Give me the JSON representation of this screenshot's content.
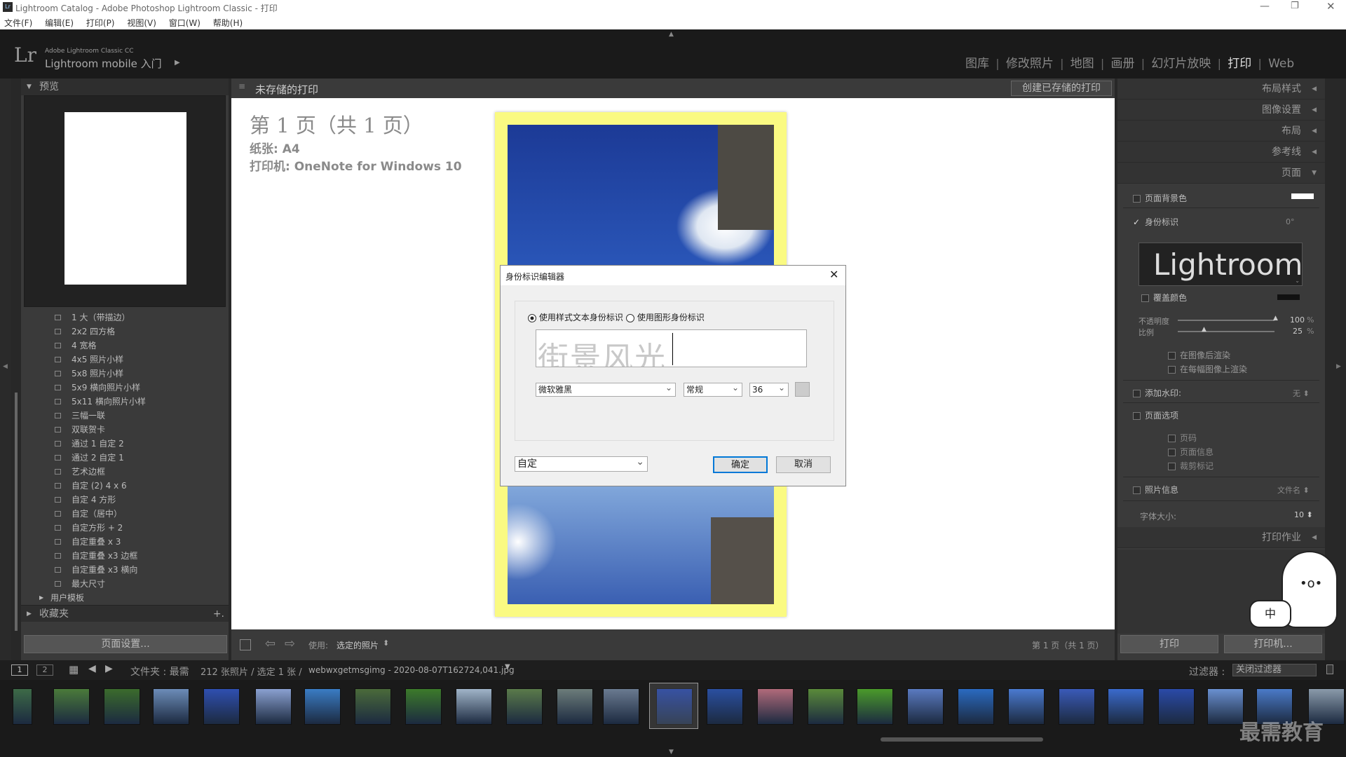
{
  "window": {
    "title": "Lightroom Catalog - Adobe Photoshop Lightroom Classic - 打印",
    "app_icon": "Lr"
  },
  "menu": [
    "文件(F)",
    "编辑(E)",
    "打印(P)",
    "视图(V)",
    "窗口(W)",
    "帮助(H)"
  ],
  "identity": {
    "logo": "Lr",
    "line1": "Adobe Lightroom Classic CC",
    "line2": "Lightroom mobile 入门"
  },
  "modules": [
    {
      "label": "图库"
    },
    {
      "label": "修改照片"
    },
    {
      "label": "地图"
    },
    {
      "label": "画册"
    },
    {
      "label": "幻灯片放映"
    },
    {
      "label": "打印",
      "active": true
    },
    {
      "label": "Web"
    }
  ],
  "left": {
    "preview_title": "预览",
    "templates": [
      "1 大（带描边）",
      "2x2 四方格",
      "4 宽格",
      "4x5 照片小样",
      "5x8 照片小样",
      "5x9 横向照片小样",
      "5x11 横向照片小样",
      "三幅一联",
      "双联贺卡",
      "通过 1 自定 2",
      "通过 2 自定 1",
      "艺术边框",
      "自定 (2) 4 x 6",
      "自定 4 方形",
      "自定（居中）",
      "自定方形 + 2",
      "自定重叠 x 3",
      "自定重叠 x3 边框",
      "自定重叠 x3 横向",
      "最大尺寸"
    ],
    "user_templates": "用户模板",
    "collections": "收藏夹",
    "collections_add": "+.",
    "page_setup_btn": "页面设置..."
  },
  "center": {
    "header_title": "未存储的打印",
    "create_saved_btn": "创建已存储的打印",
    "page_info": "第 1 页（共 1 页）",
    "paper": "纸张: A4",
    "printer": "打印机: OneNote for Windows 10",
    "use_label": "使用:",
    "use_value": "选定的照片",
    "page_counter": "第 1 页（共 1 页）"
  },
  "right": {
    "sections": [
      "布局样式",
      "图像设置",
      "布局",
      "参考线",
      "页面"
    ],
    "page_bg_label": "页面背景色",
    "identity_plate_label": "身份标识",
    "identity_angle": "0°",
    "identity_text": "Lightroom",
    "override_color": "覆盖颜色",
    "opacity_label": "不透明度",
    "opacity_value": "100",
    "opacity_unit": "%",
    "scale_label": "比例",
    "scale_value": "25",
    "scale_unit": "%",
    "render_behind": "在图像后渲染",
    "render_each": "在每幅图像上渲染",
    "watermark_label": "添加水印:",
    "watermark_value": "无 ⬍",
    "page_options": "页面选项",
    "page_numbers": "页码",
    "page_info_opt": "页面信息",
    "crop_marks": "裁剪标记",
    "photo_info": "照片信息",
    "photo_info_value": "文件名 ⬍",
    "font_size_label": "字体大小:",
    "font_size_value": "10 ⬍",
    "print_job": "打印作业",
    "print_btn": "打印",
    "printer_btn": "打印机..."
  },
  "filmstrip": {
    "page1": "1",
    "page2": "2",
    "source": "文件夹 : 最需",
    "count": "212 张照片 / 选定 1 张 /",
    "filename": "webwxgetmsgimg - 2020-08-07T162724,041.jpg",
    "filter_label": "过滤器 :",
    "filter_value": "关闭过滤器"
  },
  "dialog": {
    "title": "身份标识编辑器",
    "radio_text": "使用样式文本身份标识",
    "radio_graphic": "使用图形身份标识",
    "text_value": "街景风光",
    "font": "微软雅黑",
    "style": "常规",
    "size": "36",
    "preset": "自定",
    "ok": "确定",
    "cancel": "取消"
  },
  "watermark_corner": "最需教育",
  "ime": "中",
  "colors": {
    "page_border": "#fafa82",
    "accent": "#0078d7"
  }
}
